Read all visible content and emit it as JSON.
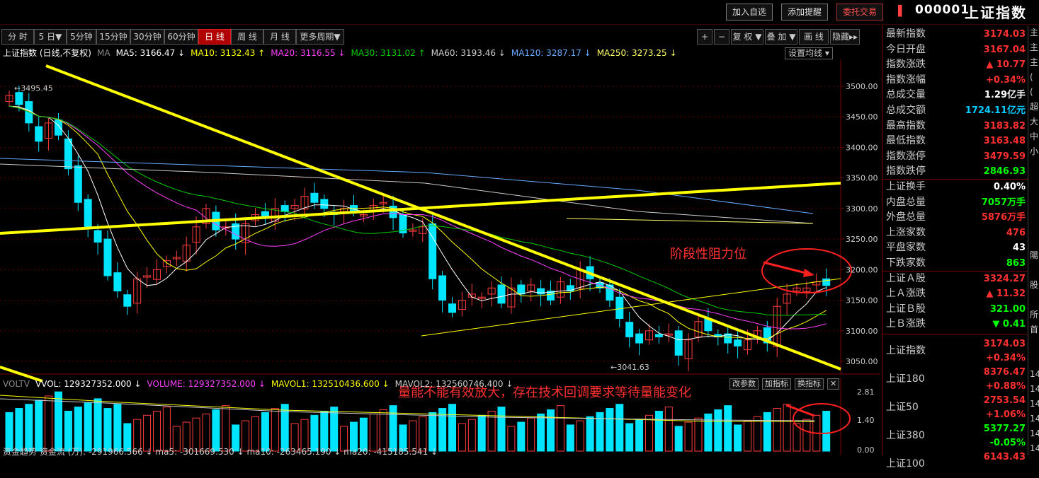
{
  "header": {
    "buttons": [
      "加入自选",
      "添加提醒",
      "委托交易"
    ],
    "code": "000001",
    "name": "上证指数"
  },
  "toolbar": {
    "periods": [
      "分 时",
      "5 日▼",
      "5分钟",
      "15分钟",
      "30分钟",
      "60分钟",
      "日 线",
      "周 线",
      "月 线",
      "更多周期▼"
    ],
    "active": "日 线",
    "right": [
      "+",
      "−",
      "复 权 ▼",
      "叠 加 ▼",
      "画 线",
      "隐藏▸▸"
    ]
  },
  "ma_info": {
    "title": "上证指数 (日线,不复权)",
    "items": [
      {
        "text": "MA",
        "color": "#888888"
      },
      {
        "text": "MA5: 3166.47 ↓",
        "color": "#ffffff"
      },
      {
        "text": "MA10: 3132.43 ↑",
        "color": "#ffff00"
      },
      {
        "text": "MA20: 3116.55 ↓",
        "color": "#ff40ff"
      },
      {
        "text": "MA30: 3131.02 ↑",
        "color": "#00cc00"
      },
      {
        "text": "MA60: 3193.46 ↓",
        "color": "#cccccc"
      },
      {
        "text": "MA120: 3287.17 ↓",
        "color": "#66aaff"
      },
      {
        "text": "MA250: 3273.25 ↓",
        "color": "#ffff66"
      }
    ],
    "setting": "设置均线 ▾"
  },
  "chart": {
    "y_ticks": [
      "3500.00",
      "3450.00",
      "3400.00",
      "3350.00",
      "3300.00",
      "3250.00",
      "3200.00",
      "3150.00",
      "3100.00",
      "3050.00"
    ],
    "high_label": "3495.45",
    "low_label": "3041.63",
    "annotation": "阶段性阻力位"
  },
  "volume": {
    "items": [
      {
        "text": "VOLTV",
        "color": "#888888"
      },
      {
        "text": "VVOL: 129327352.000 ↓",
        "color": "#ffffff"
      },
      {
        "text": "VOLUME: 129327352.000 ↓",
        "color": "#ff40ff"
      },
      {
        "text": "MAVOL1: 132510436.600 ↓",
        "color": "#ffff00"
      },
      {
        "text": "MAVOL2: 132560746.400 ↓",
        "color": "#cccccc"
      }
    ],
    "y_ticks": [
      "2.81",
      "1.40",
      "0.00"
    ],
    "annotation": "量能不能有效放大，存在技术回调要求等待量能变化",
    "buttons": [
      "改参数",
      "加指标",
      "换指标"
    ],
    "bottom": "资金趋势  资金流 (万): -291966.566 ↓ ma5: -301669.530 ↓ ma10: -263465.190 ↓ ma20: -415185.541 ↓"
  },
  "right_panel": {
    "rows": [
      {
        "label": "最新指数",
        "value": "3174.03",
        "color": "#ff3030"
      },
      {
        "label": "今日开盘",
        "value": "3167.04",
        "color": "#ff3030"
      },
      {
        "label": "指数涨跌",
        "value": "▲ 10.77",
        "color": "#ff3030"
      },
      {
        "label": "指数涨幅",
        "value": "+0.34%",
        "color": "#ff3030"
      },
      {
        "label": "总成交量",
        "value": "1.29亿手",
        "color": "#ffffff"
      },
      {
        "label": "总成交额",
        "value": "1724.11亿元",
        "color": "#00ccff"
      },
      {
        "label": "最高指数",
        "value": "3183.82",
        "color": "#ff3030"
      },
      {
        "label": "最低指数",
        "value": "3163.48",
        "color": "#ff3030"
      },
      {
        "label": "指数涨停",
        "value": "3479.59",
        "color": "#ff3030"
      },
      {
        "label": "指数跌停",
        "value": "2846.93",
        "color": "#00ff00"
      },
      {
        "label": "上证换手",
        "value": "0.40%",
        "color": "#ffffff"
      },
      {
        "label": "内盘总量",
        "value": "7057万手",
        "color": "#00ff00"
      },
      {
        "label": "外盘总量",
        "value": "5876万手",
        "color": "#ff3030"
      },
      {
        "label": "上涨家数",
        "value": "476",
        "color": "#ff3030"
      },
      {
        "label": "平盘家数",
        "value": "43",
        "color": "#ffffff"
      },
      {
        "label": "下跌家数",
        "value": "863",
        "color": "#00ff00"
      },
      {
        "label": "上证Ａ股",
        "value": "3324.27",
        "color": "#ff3030"
      },
      {
        "label": "上Ａ涨跌",
        "value": "▲ 11.32",
        "color": "#ff3030"
      },
      {
        "label": "上证Ｂ股",
        "value": "321.00",
        "color": "#00ff00"
      },
      {
        "label": "上Ｂ涨跌",
        "value": "▼ 0.41",
        "color": "#00ff00"
      }
    ],
    "indices": [
      {
        "label": "上证指数",
        "value": "3174.03",
        "pct": "+0.34%",
        "vcolor": "#ff3030",
        "pcolor": "#ff3030"
      },
      {
        "label": "上证180",
        "value": "8376.47",
        "pct": "+0.88%",
        "vcolor": "#ff3030",
        "pcolor": "#ff3030"
      },
      {
        "label": "上证50",
        "value": "2753.54",
        "pct": "+1.06%",
        "vcolor": "#ff3030",
        "pcolor": "#ff3030"
      },
      {
        "label": "上证380",
        "value": "5377.27",
        "pct": "-0.05%",
        "vcolor": "#00ff00",
        "pcolor": "#00ff00"
      },
      {
        "label": "上证100",
        "value": "6143.43",
        "pct": "",
        "vcolor": "#ff3030",
        "pcolor": "#ff3030"
      }
    ]
  },
  "edge": [
    "主",
    "主",
    "主",
    "(",
    "(",
    "超",
    "大",
    "中",
    "小",
    "",
    "",
    "",
    "",
    "",
    "",
    "陽",
    "",
    "股",
    "",
    "所",
    "首",
    "",
    "",
    "14",
    "14",
    "14",
    "14",
    "14",
    "14",
    "14"
  ]
}
